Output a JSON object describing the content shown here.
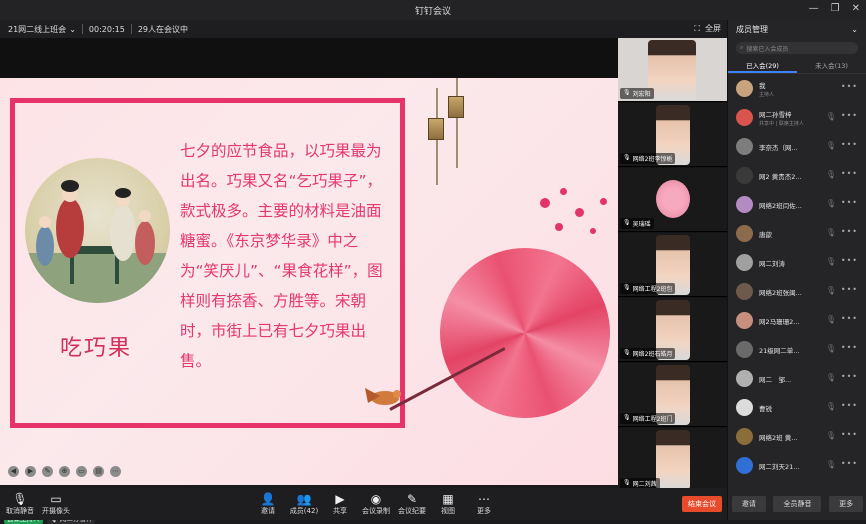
{
  "window": {
    "title": "钉钉会议"
  },
  "meeting": {
    "name": "21网二线上班会",
    "duration": "00:20:15",
    "count": "29人在会议中",
    "fullscreen": "全屏"
  },
  "slide": {
    "text": "七夕的应节食品，以巧果最为出名。巧果又名“乞巧果子”，款式极多。主要的材料是油面糖蜜。《东京梦华录》中之为“笑厌儿”、“果食花样”，图样则有捺香、方胜等。宋朝时，市街上已有七夕巧果出售。",
    "title": "吃巧果"
  },
  "speakers": {
    "host": "云课主持人",
    "speaking": "网二孙雪梓"
  },
  "thumbnails": [
    "刘宏阳",
    "网络2班李惊栀",
    "吴瑞瑶",
    "网络工程2班包",
    "网络2班石皓月",
    "网络工程2班门",
    "网二刘茜"
  ],
  "toolbar": [
    "取消静音",
    "开摄像头",
    "邀请",
    "成员(42)",
    "共享",
    "会议录制",
    "会议纪要",
    "视图",
    "更多"
  ],
  "end_button": "结束会议",
  "panel": {
    "title": "成员管理",
    "search_placeholder": "搜索已入会成员",
    "tab_joined": "已入会(29)",
    "tab_notjoined": "未入会(13)",
    "members": [
      {
        "name": "我",
        "sub": "主持人"
      },
      {
        "name": "网二孙雪梓",
        "sub": "共享中 | 联席主持人"
      },
      {
        "name": "李奈杰（网...",
        "sub": ""
      },
      {
        "name": "网2 黄贵杰2...",
        "sub": ""
      },
      {
        "name": "网络2班闫佐...",
        "sub": ""
      },
      {
        "name": "唐歆",
        "sub": ""
      },
      {
        "name": "网二刘涛",
        "sub": ""
      },
      {
        "name": "网络2班张闽...",
        "sub": ""
      },
      {
        "name": "网2马珊珊2...",
        "sub": ""
      },
      {
        "name": "21级网二单...",
        "sub": ""
      },
      {
        "name": "网二　邹...",
        "sub": ""
      },
      {
        "name": "曹锐",
        "sub": ""
      },
      {
        "name": "网络2班 黄...",
        "sub": ""
      },
      {
        "name": "网二刘天21...",
        "sub": ""
      }
    ],
    "foot": [
      "邀请",
      "全员静音",
      "更多"
    ]
  }
}
